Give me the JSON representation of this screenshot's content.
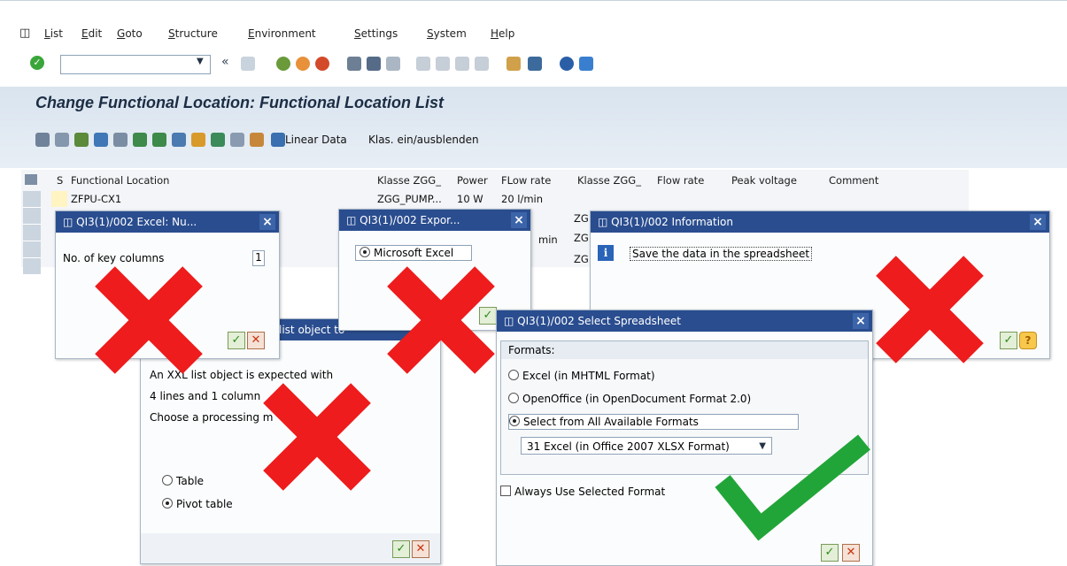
{
  "menu": {
    "items": [
      "List",
      "Edit",
      "Goto",
      "Structure",
      "Environment",
      "Settings",
      "System",
      "Help"
    ]
  },
  "page_title": "Change Functional Location: Functional Location List",
  "app_toolbar": {
    "linear_data": "Linear Data",
    "klas_toggle": "Klas. ein/ausblenden"
  },
  "table": {
    "headers": [
      "S",
      "Functional Location",
      "Klasse ZGG_",
      "Power",
      "FLow rate",
      "Klasse ZGG_",
      "Flow rate",
      "Peak voltage",
      "Comment"
    ],
    "row1": {
      "location": "ZFPU-CX1",
      "klasse": "ZGG_PUMP...",
      "power": "10 W",
      "flow": "20 l/min"
    },
    "partial": [
      "ZG",
      "min",
      "ZG",
      "ZG"
    ]
  },
  "dialog_numcols": {
    "title": "QI3(1)/002 Excel: Nu...",
    "label": "No. of key columns",
    "value": "1"
  },
  "dialog_export": {
    "title": "QI3(1)/002 Expor...",
    "option": "Microsoft Excel"
  },
  "dialog_info": {
    "title": "QI3(1)/002 Information",
    "message": "Save the data in the spreadsheet"
  },
  "dialog_xxl": {
    "title_fragment": "list object to",
    "line1": "An XXL list object is expected with",
    "line2": "4 lines and 1 column",
    "line3": "Choose a processing m",
    "opt_table": "Table",
    "opt_pivot": "Pivot table"
  },
  "dialog_spreadsheet": {
    "title": "QI3(1)/002 Select Spreadsheet",
    "group_label": "Formats:",
    "opt1": "Excel (in MHTML Format)",
    "opt2": "OpenOffice (in OpenDocument Format 2.0)",
    "opt3": "Select from All Available Formats",
    "select_value": "31 Excel (in Office 2007 XLSX Format)",
    "checkbox": "Always Use Selected Format"
  },
  "colors": {
    "title_bar": "#2a4d8f",
    "cross": "#ee1c1c",
    "check": "#21a538"
  }
}
